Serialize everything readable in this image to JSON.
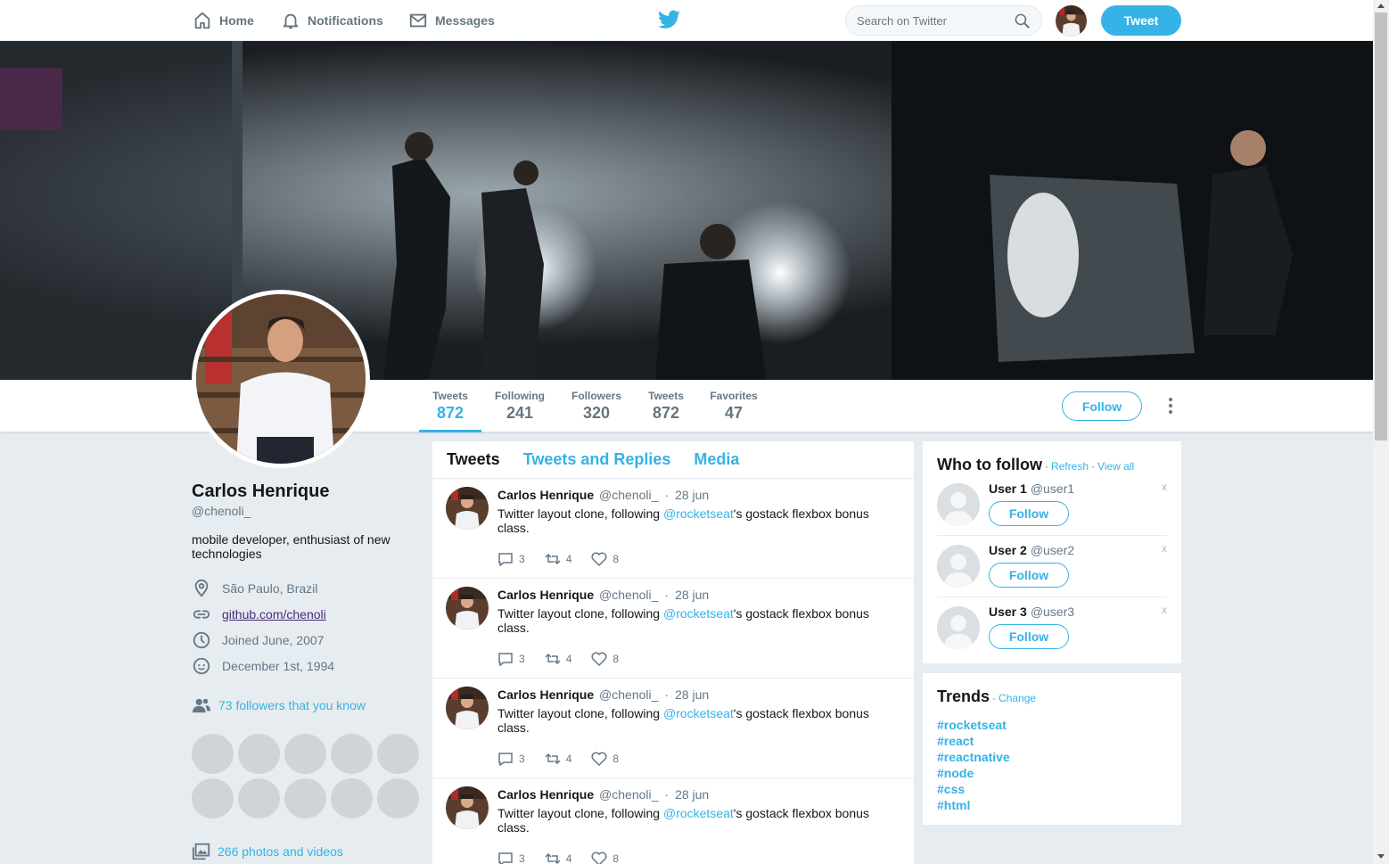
{
  "nav": {
    "home": "Home",
    "notifications": "Notifications",
    "messages": "Messages",
    "search_placeholder": "Search on Twitter",
    "tweet_button": "Tweet"
  },
  "stats": [
    {
      "label": "Tweets",
      "value": "872"
    },
    {
      "label": "Following",
      "value": "241"
    },
    {
      "label": "Followers",
      "value": "320"
    },
    {
      "label": "Tweets",
      "value": "872"
    },
    {
      "label": "Favorites",
      "value": "47"
    }
  ],
  "profile": {
    "follow_button": "Follow",
    "name": "Carlos Henrique",
    "handle": "@chenoli_",
    "bio": "mobile developer, enthusiast of new technologies",
    "location": "São Paulo, Brazil",
    "website": "github.com/chenoli",
    "joined": "Joined June, 2007",
    "birthday": "December 1st, 1994",
    "followers_you_know": "73 followers that you know",
    "photos_videos": "266 photos and videos"
  },
  "timeline": {
    "tabs": [
      "Tweets",
      "Tweets and Replies",
      "Media"
    ],
    "tweets": [
      {
        "name": "Carlos Henrique",
        "handle": "@chenoli_",
        "dot": "·",
        "date": "28 jun",
        "text_before": "Twitter layout clone, following ",
        "mention": "@rocketseat",
        "text_after": "'s gostack flexbox bonus class.",
        "replies": "3",
        "retweets": "4",
        "likes": "8"
      },
      {
        "name": "Carlos Henrique",
        "handle": "@chenoli_",
        "dot": "·",
        "date": "28 jun",
        "text_before": "Twitter layout clone, following ",
        "mention": "@rocketseat",
        "text_after": "'s gostack flexbox bonus class.",
        "replies": "3",
        "retweets": "4",
        "likes": "8"
      },
      {
        "name": "Carlos Henrique",
        "handle": "@chenoli_",
        "dot": "·",
        "date": "28 jun",
        "text_before": "Twitter layout clone, following ",
        "mention": "@rocketseat",
        "text_after": "'s gostack flexbox bonus class.",
        "replies": "3",
        "retweets": "4",
        "likes": "8"
      },
      {
        "name": "Carlos Henrique",
        "handle": "@chenoli_",
        "dot": "·",
        "date": "28 jun",
        "text_before": "Twitter layout clone, following ",
        "mention": "@rocketseat",
        "text_after": "'s gostack flexbox bonus class.",
        "replies": "3",
        "retweets": "4",
        "likes": "8"
      }
    ]
  },
  "who_to_follow": {
    "title": "Who to follow",
    "sep": "·",
    "refresh": "Refresh",
    "view_all": "View all",
    "users": [
      {
        "name": "User 1",
        "handle": "@user1",
        "button": "Follow",
        "close": "x"
      },
      {
        "name": "User 2",
        "handle": "@user2",
        "button": "Follow",
        "close": "x"
      },
      {
        "name": "User 3",
        "handle": "@user3",
        "button": "Follow",
        "close": "x"
      }
    ]
  },
  "trends": {
    "title": "Trends",
    "sep": "·",
    "change": "Change",
    "items": [
      "#rocketseat",
      "#react",
      "#reactnative",
      "#node",
      "#css",
      "#html"
    ]
  },
  "colors": {
    "accent": "#35b3e6",
    "background": "#e6ecf0",
    "muted": "#657786"
  }
}
